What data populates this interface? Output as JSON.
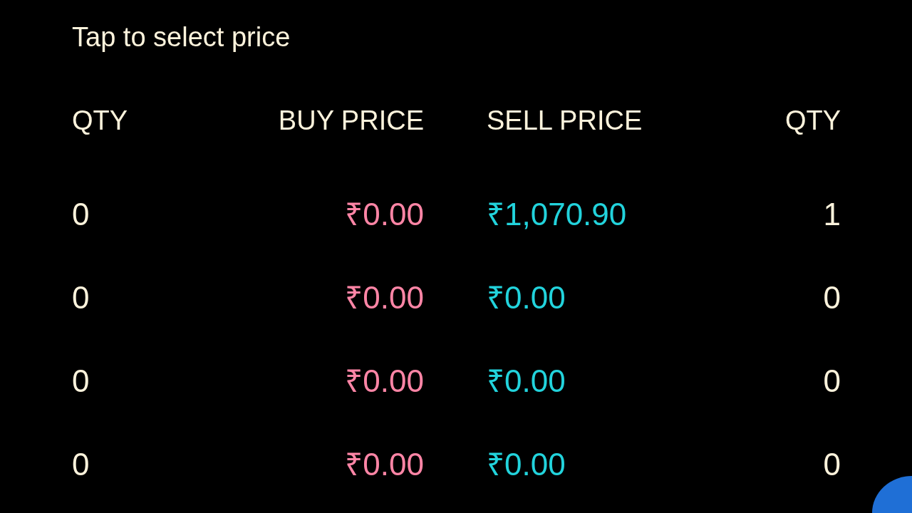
{
  "title": "Tap to select price",
  "columns": [
    {
      "label": "QTY"
    },
    {
      "label": "BUY PRICE"
    },
    {
      "label": "SELL PRICE"
    },
    {
      "label": "QTY"
    }
  ],
  "rows": [
    {
      "buy_qty": "0",
      "buy_price": "₹0.00",
      "sell_price": "₹1,070.90",
      "sell_qty": "1"
    },
    {
      "buy_qty": "0",
      "buy_price": "₹0.00",
      "sell_price": "₹0.00",
      "sell_qty": "0"
    },
    {
      "buy_qty": "0",
      "buy_price": "₹0.00",
      "sell_price": "₹0.00",
      "sell_qty": "0"
    },
    {
      "buy_qty": "0",
      "buy_price": "₹0.00",
      "sell_price": "₹0.00",
      "sell_qty": "0"
    }
  ]
}
